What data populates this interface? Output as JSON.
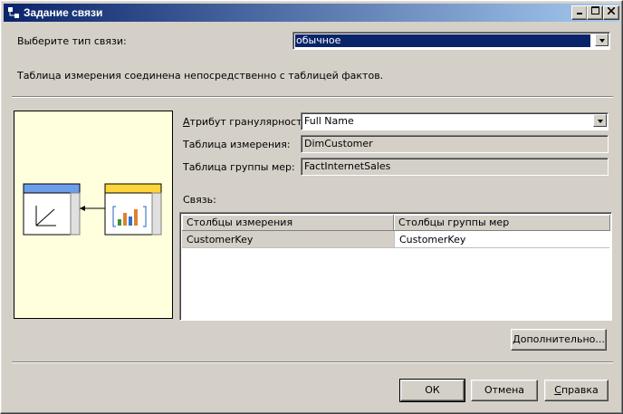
{
  "window": {
    "title": "Задание связи",
    "controls": [
      "minimize-icon",
      "maximize-icon",
      "close-icon"
    ]
  },
  "relationship_type": {
    "label": "Выберите тип связи:",
    "value": "обычное"
  },
  "description": "Таблица измерения соединена непосредственно с таблицей фактов.",
  "granularity": {
    "label": "Атрибут гранулярности:",
    "value": "Full Name"
  },
  "dimension_table": {
    "label": "Таблица измерения:",
    "value": "DimCustomer"
  },
  "measure_group_table": {
    "label": "Таблица группы мер:",
    "value": "FactInternetSales"
  },
  "relationship": {
    "label": "Связь:",
    "columns": [
      "Столбцы измерения",
      "Столбцы группы мер"
    ],
    "rows": [
      [
        "CustomerKey",
        "CustomerKey"
      ]
    ]
  },
  "buttons": {
    "advanced": "Дополнительно...",
    "ok": "ОК",
    "cancel": "Отмена",
    "help": "Справка"
  },
  "colors": {
    "title_start": "#0a246a",
    "title_end": "#a6caf0",
    "selection": "#0a246a",
    "diagram_bg": "#ffffdd",
    "dimension_header": "#6d9eeb",
    "fact_header": "#ffd43b"
  }
}
